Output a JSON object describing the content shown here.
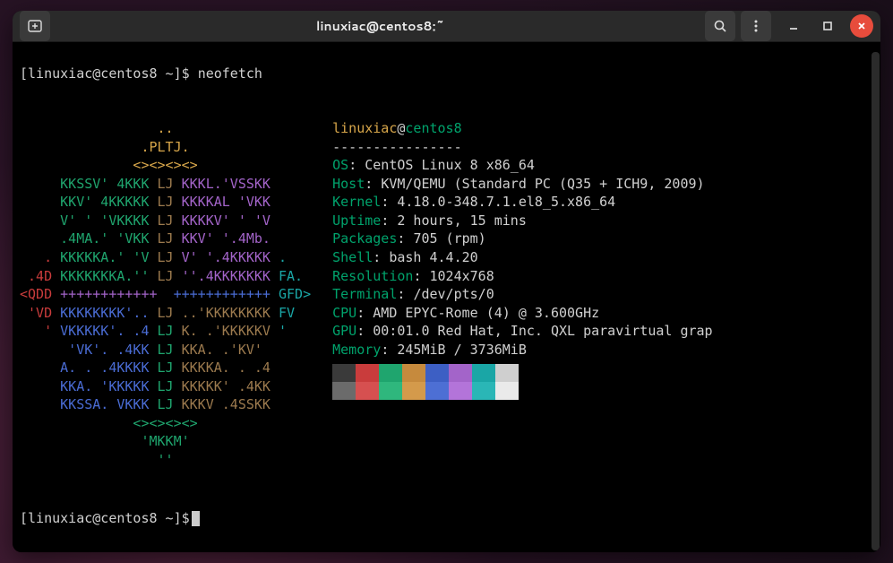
{
  "titlebar": {
    "title": "linuxiac@centos8:~"
  },
  "prompt": {
    "user_host": "[linuxiac@centos8 ~]$",
    "command": "neofetch",
    "final": "[linuxiac@centos8 ~]$"
  },
  "neofetch": {
    "header_user": "linuxiac",
    "header_at": "@",
    "header_host": "centos8",
    "sep": "----------------",
    "fields": {
      "os": {
        "label": "OS",
        "value": "CentOS Linux 8 x86_64"
      },
      "host": {
        "label": "Host",
        "value": "KVM/QEMU (Standard PC (Q35 + ICH9, 2009)"
      },
      "kernel": {
        "label": "Kernel",
        "value": "4.18.0-348.7.1.el8_5.x86_64"
      },
      "uptime": {
        "label": "Uptime",
        "value": "2 hours, 15 mins"
      },
      "packages": {
        "label": "Packages",
        "value": "705 (rpm)"
      },
      "shell": {
        "label": "Shell",
        "value": "bash 4.4.20"
      },
      "resolution": {
        "label": "Resolution",
        "value": "1024x768"
      },
      "terminal": {
        "label": "Terminal",
        "value": "/dev/pts/0"
      },
      "cpu": {
        "label": "CPU",
        "value": "AMD EPYC-Rome (4) @ 3.600GHz"
      },
      "gpu": {
        "label": "GPU",
        "value": "00:01.0 Red Hat, Inc. QXL paravirtual grap"
      },
      "memory": {
        "label": "Memory",
        "value": "245MiB / 3736MiB"
      }
    }
  },
  "ascii": {
    "l01": "                 ..",
    "l02": "               .PLTJ.",
    "l03": "              <><><><>",
    "l04a": "     KKSSV' 4KKK ",
    "l04b": "LJ ",
    "l04c": "KKKL.'VSSKK",
    "l05a": "     KKV' 4KKKKK ",
    "l05b": "LJ ",
    "l05c": "KKKKAL 'VKK",
    "l06a": "     V' ' 'VKKKK ",
    "l06b": "LJ ",
    "l06c": "KKKKV' ' 'V",
    "l07a": "     .4MA.' 'VKK ",
    "l07b": "LJ ",
    "l07c": "KKV' '.4Mb.",
    "l08a": "   .",
    "l08b": " KKKKKA.' 'V ",
    "l08c": "LJ ",
    "l08d": "V' '.4KKKKK ",
    "l08e": ".",
    "l09a": " .4D",
    "l09b": " KKKKKKKA.'' ",
    "l09c": "LJ ",
    "l09d": "''.4KKKKKKK ",
    "l09e": "FA.",
    "l10a": "<QDD",
    "l10b": " ++++++++++++",
    "l10c": "  ",
    "l10d": "++++++++++++ ",
    "l10e": "GFD>",
    "l11a": " 'VD",
    "l11b": " KKKKKKKK'.. ",
    "l11c": "LJ ",
    "l11d": "..'KKKKKKKK ",
    "l11e": "FV",
    "l12a": "   '",
    "l12b": " VKKKKK'. .4 ",
    "l12c": "LJ ",
    "l12d": "K. .'KKKKKV ",
    "l12e": "'",
    "l13a": "      'VK'. .4KK ",
    "l13b": "LJ ",
    "l13c": "KKA. .'KV'",
    "l14a": "     A. . .4KKKK ",
    "l14b": "LJ ",
    "l14c": "KKKKA. . .4",
    "l15a": "     KKA. 'KKKKK ",
    "l15b": "LJ ",
    "l15c": "KKKKK' .4KK",
    "l16a": "     KKSSA. VKKK ",
    "l16b": "LJ ",
    "l16c": "KKKV .4SSKK",
    "l17": "              <><><><>",
    "l18": "               'MKKM'",
    "l19": "                 ''"
  },
  "palette": [
    "#3a3a3a",
    "#c93c3c",
    "#1fa56e",
    "#c68a3d",
    "#3d5fc4",
    "#a364c9",
    "#1aa6a6",
    "#cfcfcf",
    "#6b6b6b",
    "#d65050",
    "#2fb77d",
    "#d49a4b",
    "#4d6fd4",
    "#b374d9",
    "#2ab6b6",
    "#eaeaea"
  ],
  "colon": ": "
}
